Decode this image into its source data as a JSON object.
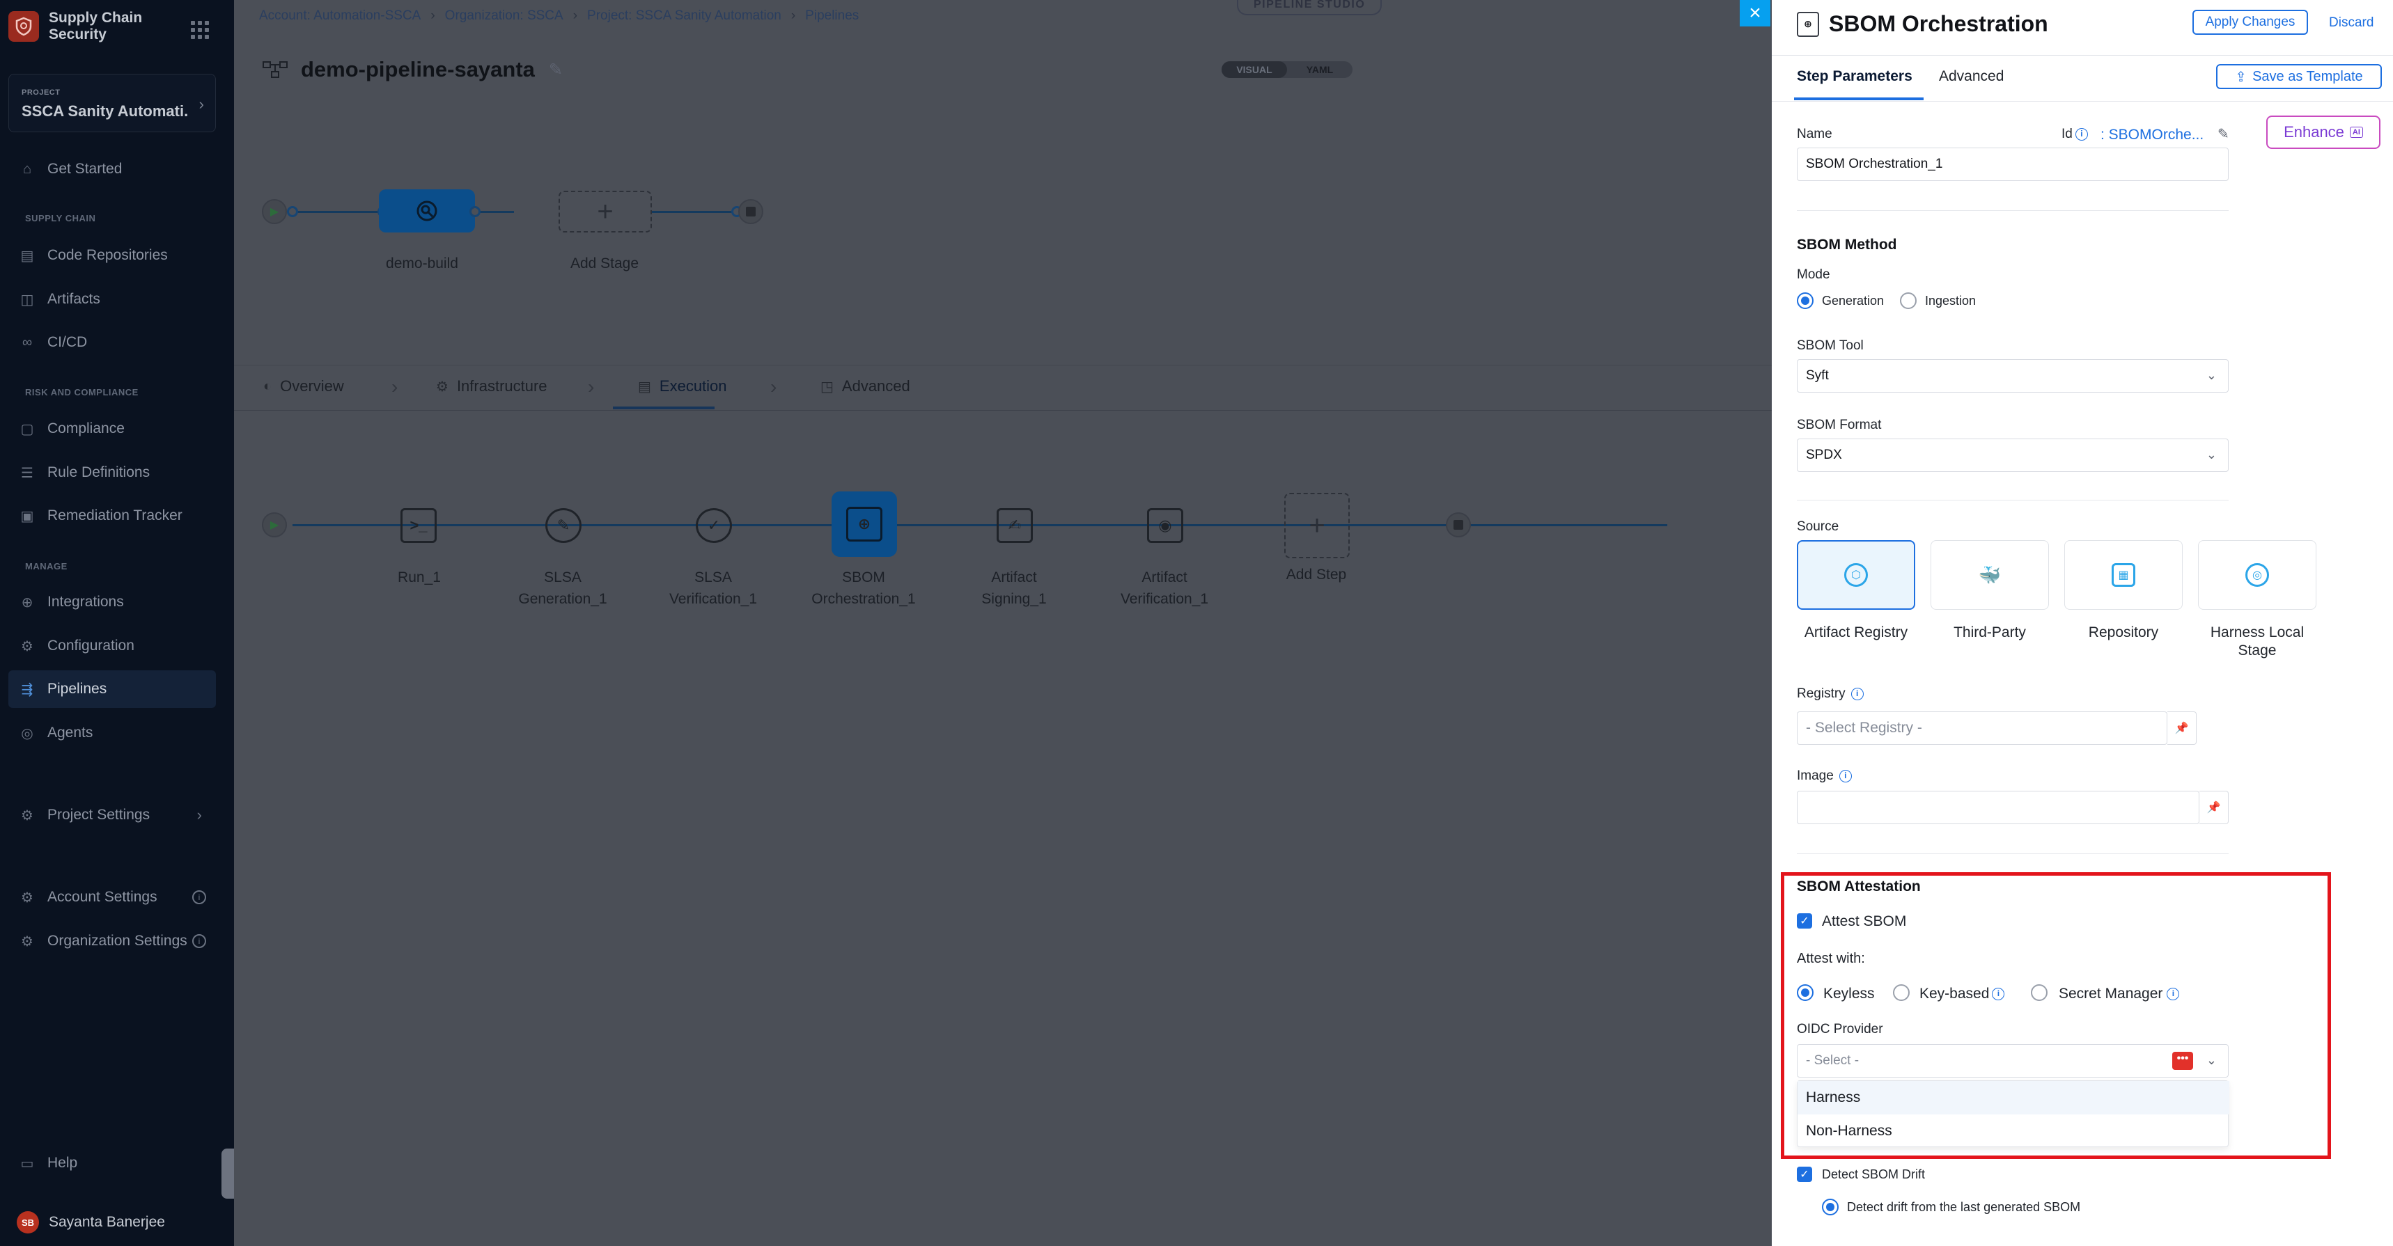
{
  "sidebar": {
    "brand": "Supply Chain Security",
    "project_label": "PROJECT",
    "project_name": "SSCA Sanity Automati...",
    "sections": {
      "supply_chain": "SUPPLY CHAIN",
      "risk": "RISK AND COMPLIANCE",
      "manage": "MANAGE"
    },
    "items": {
      "get_started": "Get Started",
      "code_repositories": "Code Repositories",
      "artifacts": "Artifacts",
      "cicd": "CI/CD",
      "compliance": "Compliance",
      "rule_definitions": "Rule Definitions",
      "remediation_tracker": "Remediation Tracker",
      "integrations": "Integrations",
      "configuration": "Configuration",
      "pipelines": "Pipelines",
      "agents": "Agents",
      "project_settings": "Project Settings",
      "account_settings": "Account Settings",
      "organization_settings": "Organization Settings",
      "help": "Help"
    },
    "user": {
      "initials": "SB",
      "name": "Sayanta Banerjee"
    }
  },
  "breadcrumb": [
    "Account: Automation-SSCA",
    "Organization: SSCA",
    "Project: SSCA Sanity Automation",
    "Pipelines"
  ],
  "studio_label": "PIPELINE STUDIO",
  "pipeline_name": "demo-pipeline-sayanta",
  "view_toggle": {
    "visual": "VISUAL",
    "yaml": "YAML"
  },
  "stages": {
    "build": "demo-build",
    "add": "Add Stage"
  },
  "stage_tabs": {
    "overview": "Overview",
    "infrastructure": "Infrastructure",
    "execution": "Execution",
    "advanced": "Advanced"
  },
  "steps": {
    "run": "Run_1",
    "slsa_gen_1": "SLSA",
    "slsa_gen_2": "Generation_1",
    "slsa_ver_1": "SLSA",
    "slsa_ver_2": "Verification_1",
    "sbom_1": "SBOM",
    "sbom_2": "Orchestration_1",
    "art_sign_1": "Artifact",
    "art_sign_2": "Signing_1",
    "art_ver_1": "Artifact",
    "art_ver_2": "Verification_1",
    "add": "Add Step"
  },
  "panel": {
    "title": "SBOM Orchestration",
    "apply": "Apply Changes",
    "discard": "Discard",
    "tabs": {
      "step_params": "Step Parameters",
      "advanced": "Advanced"
    },
    "save_template": "Save as Template",
    "enhance": "Enhance",
    "enhance_badge": "AI",
    "name_label": "Name",
    "id_label": "Id",
    "id_value": ": SBOMOrche...",
    "name_value": "SBOM Orchestration_1",
    "sbom_method": "SBOM Method",
    "mode_label": "Mode",
    "mode_generation": "Generation",
    "mode_ingestion": "Ingestion",
    "tool_label": "SBOM Tool",
    "tool_value": "Syft",
    "format_label": "SBOM Format",
    "format_value": "SPDX",
    "source_label": "Source",
    "sources": {
      "artifact_registry": "Artifact Registry",
      "third_party": "Third-Party",
      "repository": "Repository",
      "harness_local_1": "Harness Local",
      "harness_local_2": "Stage"
    },
    "registry_label": "Registry",
    "registry_placeholder": "- Select Registry -",
    "image_label": "Image",
    "attestation_title": "SBOM Attestation",
    "attest_sbom": "Attest SBOM",
    "attest_with": "Attest with:",
    "attest_keyless": "Keyless",
    "attest_keybased": "Key-based",
    "attest_secret": "Secret Manager",
    "oidc_label": "OIDC Provider",
    "oidc_placeholder": "- Select -",
    "oidc_options": [
      "Harness",
      "Non-Harness"
    ],
    "detect_drift": "Detect SBOM Drift",
    "drift_option": "Detect drift from the last generated SBOM"
  },
  "colors": {
    "accent": "#1d6fe0",
    "highlight": "#e3141b",
    "sidebar_bg": "#0a1220"
  }
}
